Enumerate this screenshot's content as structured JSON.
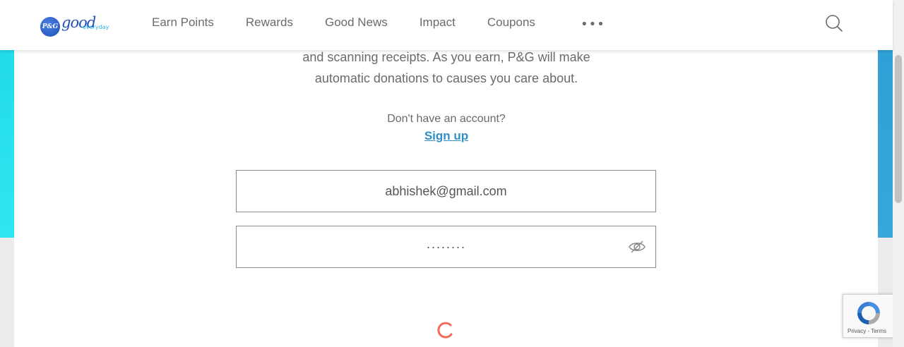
{
  "brand": {
    "badge": "P&G",
    "name": "good",
    "tagline": "everyday"
  },
  "nav": {
    "items": [
      "Earn Points",
      "Rewards",
      "Good News",
      "Impact",
      "Coupons"
    ],
    "more": "•••"
  },
  "intro": {
    "line1": "and scanning receipts. As you earn, P&G will make",
    "line2": "automatic donations to causes you care about."
  },
  "signup": {
    "prompt": "Don't have an account?",
    "link": "Sign up"
  },
  "form": {
    "email_value": "abhishek@gmail.com",
    "password_value": "········"
  },
  "recaptcha": {
    "text": "Privacy - Terms"
  },
  "colors": {
    "accent_left": "#2ee6f0",
    "accent_right": "#35a7dc",
    "link": "#2f8fc7",
    "spinner": "#f26b5b"
  },
  "icons": [
    "search-icon",
    "eye-slash-icon",
    "loading-spinner-icon",
    "recaptcha-icon"
  ]
}
